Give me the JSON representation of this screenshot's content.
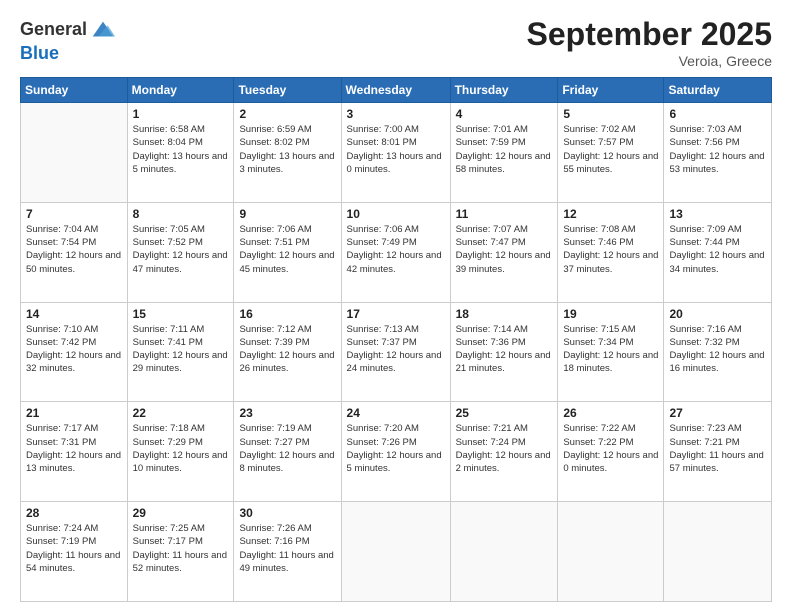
{
  "logo": {
    "general": "General",
    "blue": "Blue"
  },
  "title": "September 2025",
  "location": "Veroia, Greece",
  "days_of_week": [
    "Sunday",
    "Monday",
    "Tuesday",
    "Wednesday",
    "Thursday",
    "Friday",
    "Saturday"
  ],
  "weeks": [
    [
      {
        "day": "",
        "sunrise": "",
        "sunset": "",
        "daylight": ""
      },
      {
        "day": "1",
        "sunrise": "Sunrise: 6:58 AM",
        "sunset": "Sunset: 8:04 PM",
        "daylight": "Daylight: 13 hours and 5 minutes."
      },
      {
        "day": "2",
        "sunrise": "Sunrise: 6:59 AM",
        "sunset": "Sunset: 8:02 PM",
        "daylight": "Daylight: 13 hours and 3 minutes."
      },
      {
        "day": "3",
        "sunrise": "Sunrise: 7:00 AM",
        "sunset": "Sunset: 8:01 PM",
        "daylight": "Daylight: 13 hours and 0 minutes."
      },
      {
        "day": "4",
        "sunrise": "Sunrise: 7:01 AM",
        "sunset": "Sunset: 7:59 PM",
        "daylight": "Daylight: 12 hours and 58 minutes."
      },
      {
        "day": "5",
        "sunrise": "Sunrise: 7:02 AM",
        "sunset": "Sunset: 7:57 PM",
        "daylight": "Daylight: 12 hours and 55 minutes."
      },
      {
        "day": "6",
        "sunrise": "Sunrise: 7:03 AM",
        "sunset": "Sunset: 7:56 PM",
        "daylight": "Daylight: 12 hours and 53 minutes."
      }
    ],
    [
      {
        "day": "7",
        "sunrise": "Sunrise: 7:04 AM",
        "sunset": "Sunset: 7:54 PM",
        "daylight": "Daylight: 12 hours and 50 minutes."
      },
      {
        "day": "8",
        "sunrise": "Sunrise: 7:05 AM",
        "sunset": "Sunset: 7:52 PM",
        "daylight": "Daylight: 12 hours and 47 minutes."
      },
      {
        "day": "9",
        "sunrise": "Sunrise: 7:06 AM",
        "sunset": "Sunset: 7:51 PM",
        "daylight": "Daylight: 12 hours and 45 minutes."
      },
      {
        "day": "10",
        "sunrise": "Sunrise: 7:06 AM",
        "sunset": "Sunset: 7:49 PM",
        "daylight": "Daylight: 12 hours and 42 minutes."
      },
      {
        "day": "11",
        "sunrise": "Sunrise: 7:07 AM",
        "sunset": "Sunset: 7:47 PM",
        "daylight": "Daylight: 12 hours and 39 minutes."
      },
      {
        "day": "12",
        "sunrise": "Sunrise: 7:08 AM",
        "sunset": "Sunset: 7:46 PM",
        "daylight": "Daylight: 12 hours and 37 minutes."
      },
      {
        "day": "13",
        "sunrise": "Sunrise: 7:09 AM",
        "sunset": "Sunset: 7:44 PM",
        "daylight": "Daylight: 12 hours and 34 minutes."
      }
    ],
    [
      {
        "day": "14",
        "sunrise": "Sunrise: 7:10 AM",
        "sunset": "Sunset: 7:42 PM",
        "daylight": "Daylight: 12 hours and 32 minutes."
      },
      {
        "day": "15",
        "sunrise": "Sunrise: 7:11 AM",
        "sunset": "Sunset: 7:41 PM",
        "daylight": "Daylight: 12 hours and 29 minutes."
      },
      {
        "day": "16",
        "sunrise": "Sunrise: 7:12 AM",
        "sunset": "Sunset: 7:39 PM",
        "daylight": "Daylight: 12 hours and 26 minutes."
      },
      {
        "day": "17",
        "sunrise": "Sunrise: 7:13 AM",
        "sunset": "Sunset: 7:37 PM",
        "daylight": "Daylight: 12 hours and 24 minutes."
      },
      {
        "day": "18",
        "sunrise": "Sunrise: 7:14 AM",
        "sunset": "Sunset: 7:36 PM",
        "daylight": "Daylight: 12 hours and 21 minutes."
      },
      {
        "day": "19",
        "sunrise": "Sunrise: 7:15 AM",
        "sunset": "Sunset: 7:34 PM",
        "daylight": "Daylight: 12 hours and 18 minutes."
      },
      {
        "day": "20",
        "sunrise": "Sunrise: 7:16 AM",
        "sunset": "Sunset: 7:32 PM",
        "daylight": "Daylight: 12 hours and 16 minutes."
      }
    ],
    [
      {
        "day": "21",
        "sunrise": "Sunrise: 7:17 AM",
        "sunset": "Sunset: 7:31 PM",
        "daylight": "Daylight: 12 hours and 13 minutes."
      },
      {
        "day": "22",
        "sunrise": "Sunrise: 7:18 AM",
        "sunset": "Sunset: 7:29 PM",
        "daylight": "Daylight: 12 hours and 10 minutes."
      },
      {
        "day": "23",
        "sunrise": "Sunrise: 7:19 AM",
        "sunset": "Sunset: 7:27 PM",
        "daylight": "Daylight: 12 hours and 8 minutes."
      },
      {
        "day": "24",
        "sunrise": "Sunrise: 7:20 AM",
        "sunset": "Sunset: 7:26 PM",
        "daylight": "Daylight: 12 hours and 5 minutes."
      },
      {
        "day": "25",
        "sunrise": "Sunrise: 7:21 AM",
        "sunset": "Sunset: 7:24 PM",
        "daylight": "Daylight: 12 hours and 2 minutes."
      },
      {
        "day": "26",
        "sunrise": "Sunrise: 7:22 AM",
        "sunset": "Sunset: 7:22 PM",
        "daylight": "Daylight: 12 hours and 0 minutes."
      },
      {
        "day": "27",
        "sunrise": "Sunrise: 7:23 AM",
        "sunset": "Sunset: 7:21 PM",
        "daylight": "Daylight: 11 hours and 57 minutes."
      }
    ],
    [
      {
        "day": "28",
        "sunrise": "Sunrise: 7:24 AM",
        "sunset": "Sunset: 7:19 PM",
        "daylight": "Daylight: 11 hours and 54 minutes."
      },
      {
        "day": "29",
        "sunrise": "Sunrise: 7:25 AM",
        "sunset": "Sunset: 7:17 PM",
        "daylight": "Daylight: 11 hours and 52 minutes."
      },
      {
        "day": "30",
        "sunrise": "Sunrise: 7:26 AM",
        "sunset": "Sunset: 7:16 PM",
        "daylight": "Daylight: 11 hours and 49 minutes."
      },
      {
        "day": "",
        "sunrise": "",
        "sunset": "",
        "daylight": ""
      },
      {
        "day": "",
        "sunrise": "",
        "sunset": "",
        "daylight": ""
      },
      {
        "day": "",
        "sunrise": "",
        "sunset": "",
        "daylight": ""
      },
      {
        "day": "",
        "sunrise": "",
        "sunset": "",
        "daylight": ""
      }
    ]
  ]
}
